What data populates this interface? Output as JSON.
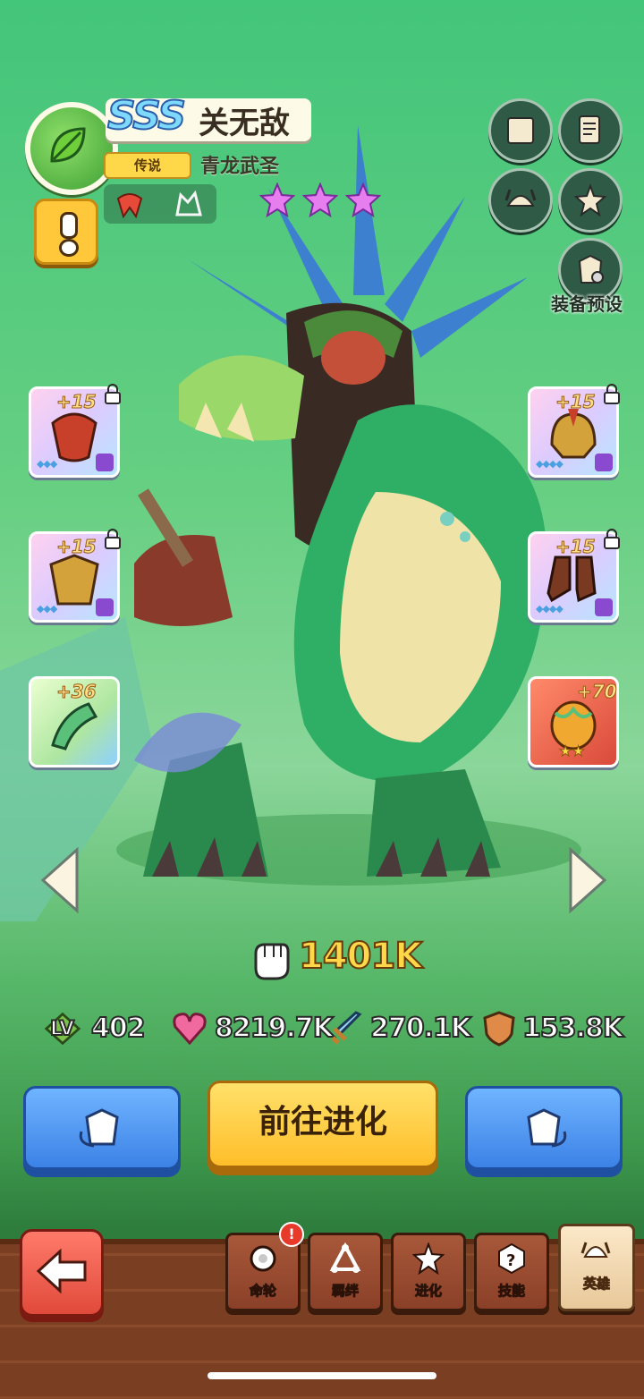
{
  "hero": {
    "grade": "SSS",
    "name": "关无敌",
    "rarity": "传说",
    "title": "青龙武圣",
    "star_count": 3,
    "element_icon": "leaf-icon"
  },
  "side_buttons": {
    "equipment_preset_label": "装备预设"
  },
  "equipment": {
    "left": [
      {
        "level": "+15",
        "locked": true
      },
      {
        "level": "+15",
        "locked": true
      },
      {
        "level": "+36",
        "locked": false
      }
    ],
    "right": [
      {
        "level": "+15",
        "locked": true
      },
      {
        "level": "+15",
        "locked": true
      },
      {
        "level": "+70",
        "locked": false,
        "stars": "★★"
      }
    ]
  },
  "power": {
    "value": "1401K"
  },
  "stats": {
    "level_label": "LV",
    "level": "402",
    "hp": "8219.7K",
    "attack": "270.1K",
    "defense": "153.8K"
  },
  "actions": {
    "evolve_label": "前往进化"
  },
  "tabs": [
    {
      "label": "命轮",
      "alert": "!"
    },
    {
      "label": "羁绊"
    },
    {
      "label": "进化"
    },
    {
      "label": "技能"
    },
    {
      "label": "英雄"
    }
  ],
  "colors": {
    "accent_gold": "#ffd84a",
    "button_blue": "#3c82e6",
    "back_red": "#e04a3a"
  }
}
